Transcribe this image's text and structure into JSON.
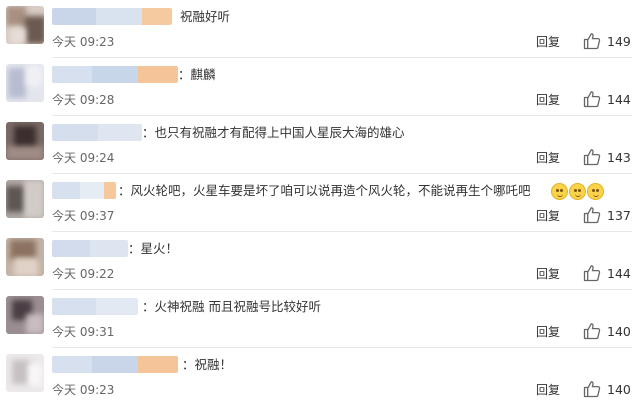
{
  "comments": [
    {
      "text": "祝融好听",
      "time": "今天 09:23",
      "reply": "回复",
      "likes": "149"
    },
    {
      "text": "：麒麟",
      "time": "今天 09:28",
      "reply": "回复",
      "likes": "144"
    },
    {
      "text": "：也只有祝融才有配得上中国人星辰大海的雄心",
      "time": "今天 09:24",
      "reply": "回复",
      "likes": "143"
    },
    {
      "text": "：风火轮吧，火星车要是坏了咱可以说再造个风火轮，不能说再生个哪吒吧",
      "time": "今天 09:37",
      "reply": "回复",
      "likes": "137"
    },
    {
      "text": "：星火！",
      "time": "今天 09:22",
      "reply": "回复",
      "likes": "144"
    },
    {
      "text": "：火神祝融 而且祝融号比较好听",
      "time": "今天 09:31",
      "reply": "回复",
      "likes": "140"
    },
    {
      "text": "：祝融！",
      "time": "今天 09:23",
      "reply": "回复",
      "likes": "140"
    }
  ],
  "icons": {
    "like": "thumbs-up-icon",
    "emoji": "laughing-face-icon"
  },
  "colors": {
    "text": "#333333",
    "meta": "#666666",
    "divider": "#e8e8e8"
  }
}
